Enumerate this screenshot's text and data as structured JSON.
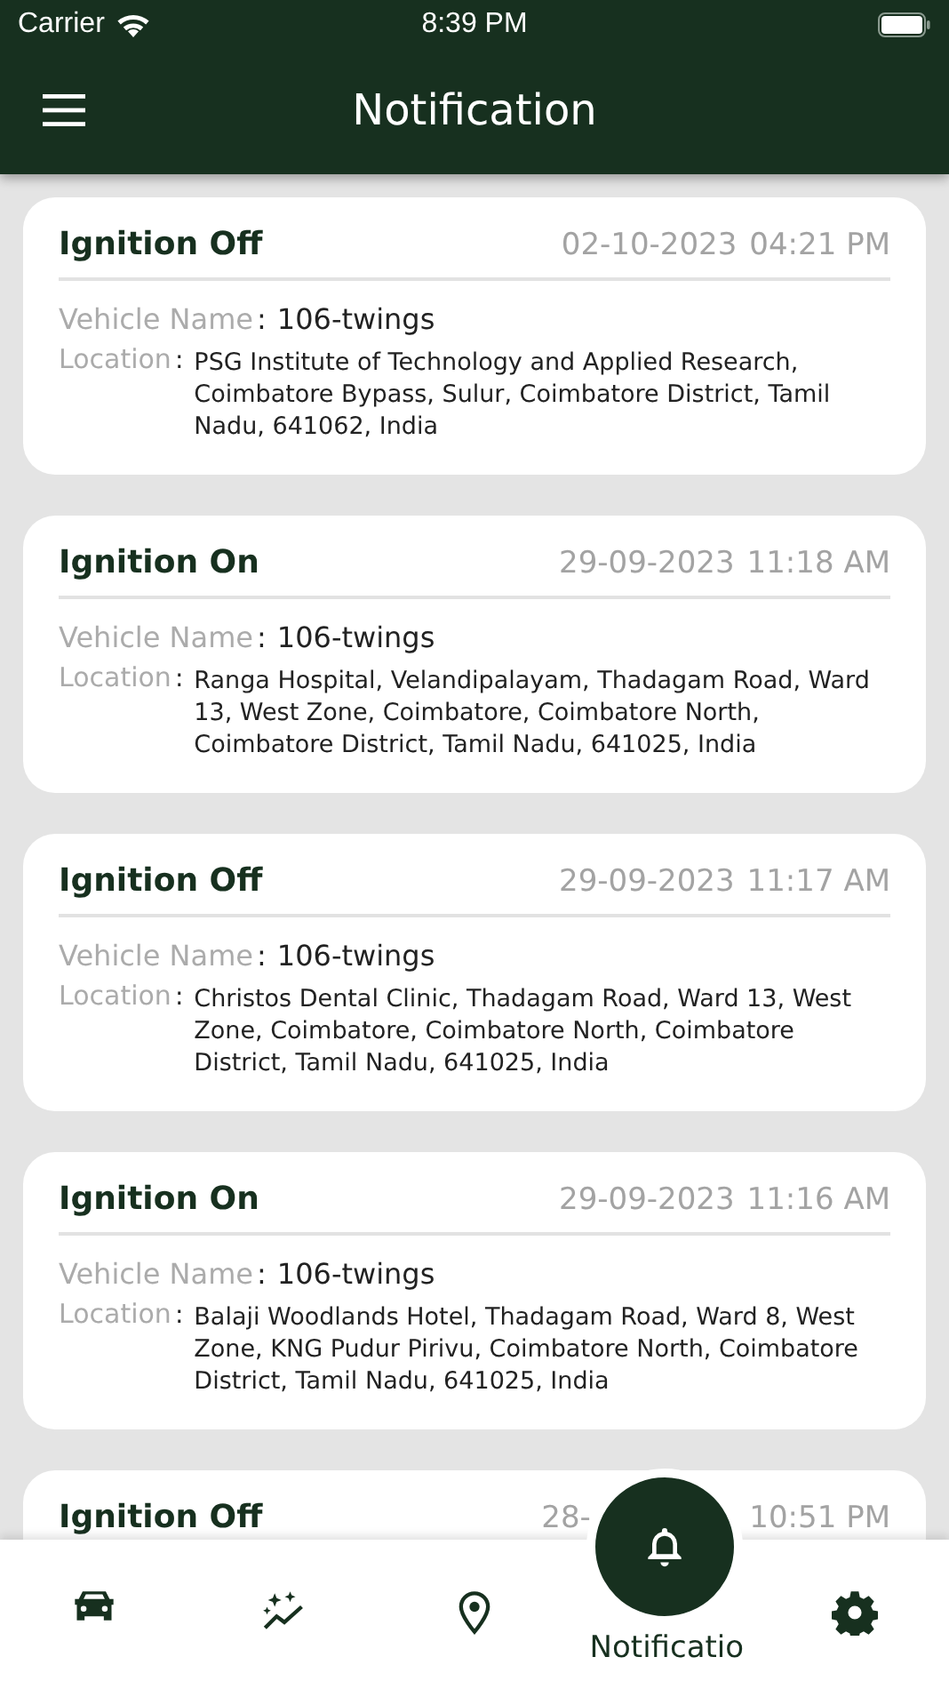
{
  "status_bar": {
    "carrier": "Carrier",
    "time": "8:39 PM"
  },
  "header": {
    "title": "Notification"
  },
  "notifications": [
    {
      "event": "Ignition Off",
      "date": "02-10-2023",
      "time": "04:21 PM",
      "obscured": false,
      "separator": ":",
      "vehicle_label": "Vehicle Name",
      "vehicle": "106-twings",
      "location_label": "Location",
      "location": "PSG Institute of Technology and Applied Research, Coimbatore Bypass, Sulur, Coimbatore District, Tamil Nadu, 641062, India"
    },
    {
      "event": "Ignition On",
      "date": "29-09-2023",
      "time": "11:18 AM",
      "obscured": false,
      "separator": ":",
      "vehicle_label": "Vehicle Name",
      "vehicle": "106-twings",
      "location_label": "Location",
      "location": "Ranga Hospital, Velandipalayam, Thadagam Road, Ward 13, West Zone, Coimbatore, Coimbatore North, Coimbatore District, Tamil Nadu, 641025, India"
    },
    {
      "event": "Ignition Off",
      "date": "29-09-2023",
      "time": "11:17 AM",
      "obscured": false,
      "separator": ":",
      "vehicle_label": "Vehicle Name",
      "vehicle": "106-twings",
      "location_label": "Location",
      "location": "Christos Dental Clinic, Thadagam Road, Ward 13, West Zone, Coimbatore, Coimbatore North, Coimbatore District, Tamil Nadu, 641025, India"
    },
    {
      "event": "Ignition On",
      "date": "29-09-2023",
      "time": "11:16 AM",
      "obscured": false,
      "separator": ":",
      "vehicle_label": "Vehicle Name",
      "vehicle": "106-twings",
      "location_label": "Location",
      "location": "Balaji Woodlands Hotel, Thadagam Road, Ward 8, West Zone, KNG Pudur Pirivu, Coimbatore North, Coimbatore District, Tamil Nadu, 641025, India"
    },
    {
      "event": "Ignition Off",
      "date": "28-",
      "time": "10:51 PM",
      "obscured": true
    }
  ],
  "tabs": [
    {
      "kind": "car",
      "selected": false
    },
    {
      "kind": "trend",
      "selected": false
    },
    {
      "kind": "pin",
      "selected": false
    },
    {
      "kind": "bell",
      "label": "Notificatio",
      "selected": true
    },
    {
      "kind": "gear",
      "selected": false
    }
  ]
}
